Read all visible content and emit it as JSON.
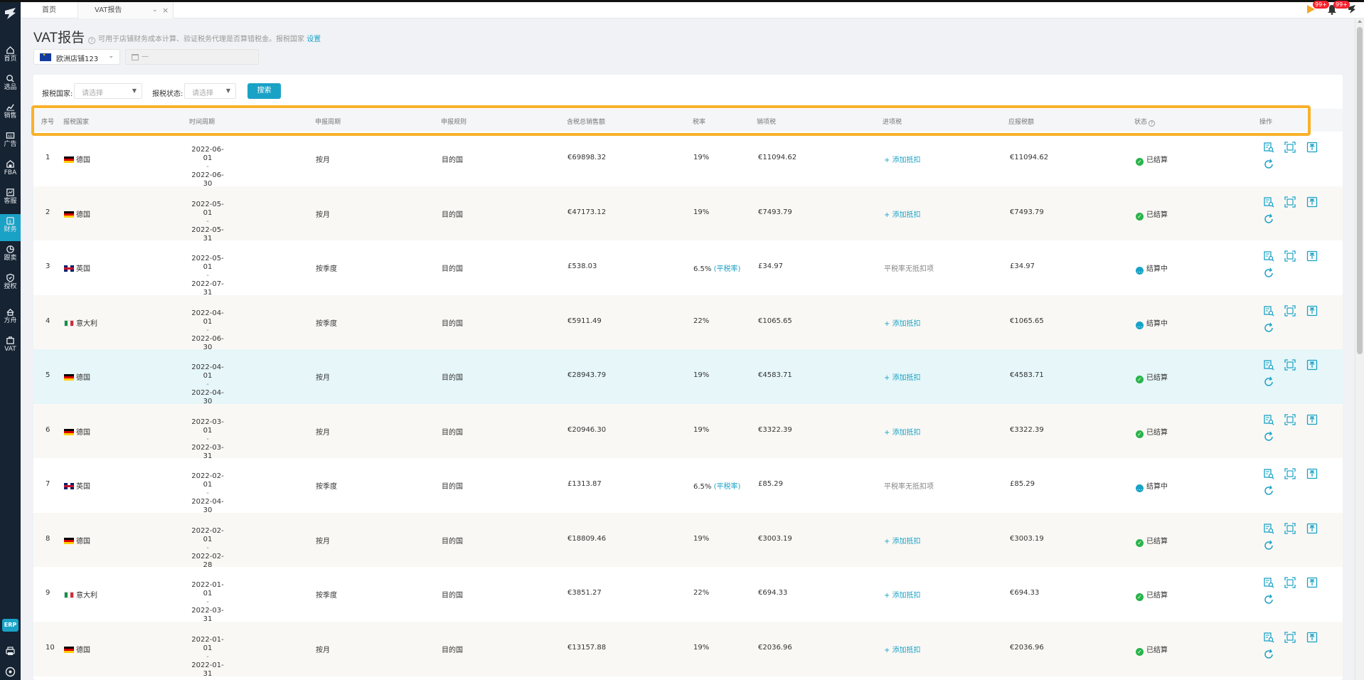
{
  "tabs": {
    "home": "首页",
    "current": "VAT报告"
  },
  "badges": {
    "msg": "99+",
    "notice": "99+"
  },
  "sidebar": {
    "items": [
      {
        "label": "首页",
        "icon": "home-icon"
      },
      {
        "label": "选品",
        "icon": "search-icon"
      },
      {
        "label": "销售",
        "icon": "chart-icon"
      },
      {
        "label": "广告",
        "icon": "ad-icon"
      },
      {
        "label": "FBA",
        "icon": "warehouse-icon"
      },
      {
        "label": "客服",
        "icon": "service-icon"
      },
      {
        "label": "财务",
        "icon": "finance-icon"
      },
      {
        "label": "跟卖",
        "icon": "pie-icon"
      },
      {
        "label": "授权",
        "icon": "shield-icon"
      },
      {
        "label": "方舟",
        "icon": "ark-icon"
      },
      {
        "label": "VAT",
        "icon": "vat-icon"
      }
    ],
    "erp": "ERP"
  },
  "header": {
    "title": "VAT报告",
    "hint": "可用于店铺财务成本计算、验证税务代理是否算错税金。报税国家",
    "hint_link": "设置",
    "store": "欧洲店铺123",
    "date_placeholder": "—"
  },
  "filters": {
    "country_label": "报税国家:",
    "country_placeholder": "请选择",
    "status_label": "报税状态:",
    "status_placeholder": "请选择",
    "search_label": "搜索"
  },
  "table": {
    "headers": {
      "index": "序号",
      "country": "报税国家",
      "period": "时间周期",
      "report_period": "申报周期",
      "rule": "申报规则",
      "sales": "含税总销售额",
      "rate": "税率",
      "output_tax": "销项税",
      "input_tax": "进项税",
      "payable": "应报税额",
      "status": "状态",
      "action": "操作"
    },
    "rows": [
      {
        "no": "1",
        "flag": "de",
        "country": "德国",
        "start": "2022-06-01",
        "end": "2022-06-30",
        "cycle": "按月",
        "rule": "目的国",
        "sales": "€69898.32",
        "rate": "19%",
        "flat": "",
        "output": "€11094.62",
        "input": "+ 添加抵扣",
        "input_link": true,
        "payable": "€11094.62",
        "status": "已结算",
        "st": "done"
      },
      {
        "no": "2",
        "flag": "de",
        "country": "德国",
        "start": "2022-05-01",
        "end": "2022-05-31",
        "cycle": "按月",
        "rule": "目的国",
        "sales": "€47173.12",
        "rate": "19%",
        "flat": "",
        "output": "€7493.79",
        "input": "+ 添加抵扣",
        "input_link": true,
        "payable": "€7493.79",
        "status": "已结算",
        "st": "done"
      },
      {
        "no": "3",
        "flag": "gb",
        "country": "英国",
        "start": "2022-05-01",
        "end": "2022-07-31",
        "cycle": "按季度",
        "rule": "目的国",
        "sales": "£538.03",
        "rate": "6.5%",
        "flat": "(平税率)",
        "output": "£34.97",
        "input": "平税率无抵扣项",
        "input_link": false,
        "payable": "£34.97",
        "status": "结算中",
        "st": "pending"
      },
      {
        "no": "4",
        "flag": "it",
        "country": "意大利",
        "start": "2022-04-01",
        "end": "2022-06-30",
        "cycle": "按季度",
        "rule": "目的国",
        "sales": "€5911.49",
        "rate": "22%",
        "flat": "",
        "output": "€1065.65",
        "input": "+ 添加抵扣",
        "input_link": true,
        "payable": "€1065.65",
        "status": "结算中",
        "st": "pending"
      },
      {
        "no": "5",
        "flag": "de",
        "country": "德国",
        "start": "2022-04-01",
        "end": "2022-04-30",
        "cycle": "按月",
        "rule": "目的国",
        "sales": "€28943.79",
        "rate": "19%",
        "flat": "",
        "output": "€4583.71",
        "input": "+ 添加抵扣",
        "input_link": true,
        "payable": "€4583.71",
        "status": "已结算",
        "st": "done"
      },
      {
        "no": "6",
        "flag": "de",
        "country": "德国",
        "start": "2022-03-01",
        "end": "2022-03-31",
        "cycle": "按月",
        "rule": "目的国",
        "sales": "€20946.30",
        "rate": "19%",
        "flat": "",
        "output": "€3322.39",
        "input": "+ 添加抵扣",
        "input_link": true,
        "payable": "€3322.39",
        "status": "已结算",
        "st": "done"
      },
      {
        "no": "7",
        "flag": "gb",
        "country": "英国",
        "start": "2022-02-01",
        "end": "2022-04-30",
        "cycle": "按季度",
        "rule": "目的国",
        "sales": "£1313.87",
        "rate": "6.5%",
        "flat": "(平税率)",
        "output": "£85.29",
        "input": "平税率无抵扣项",
        "input_link": false,
        "payable": "£85.29",
        "status": "结算中",
        "st": "pending"
      },
      {
        "no": "8",
        "flag": "de",
        "country": "德国",
        "start": "2022-02-01",
        "end": "2022-02-28",
        "cycle": "按月",
        "rule": "目的国",
        "sales": "€18809.46",
        "rate": "19%",
        "flat": "",
        "output": "€3003.19",
        "input": "+ 添加抵扣",
        "input_link": true,
        "payable": "€3003.19",
        "status": "已结算",
        "st": "done"
      },
      {
        "no": "9",
        "flag": "it",
        "country": "意大利",
        "start": "2022-01-01",
        "end": "2022-03-31",
        "cycle": "按季度",
        "rule": "目的国",
        "sales": "€3851.27",
        "rate": "22%",
        "flat": "",
        "output": "€694.33",
        "input": "+ 添加抵扣",
        "input_link": true,
        "payable": "€694.33",
        "status": "已结算",
        "st": "done"
      },
      {
        "no": "10",
        "flag": "de",
        "country": "德国",
        "start": "2022-01-01",
        "end": "2022-01-31",
        "cycle": "按月",
        "rule": "目的国",
        "sales": "€13157.88",
        "rate": "19%",
        "flat": "",
        "output": "€2036.96",
        "input": "+ 添加抵扣",
        "input_link": true,
        "payable": "€2036.96",
        "status": "已结算",
        "st": "done"
      }
    ]
  },
  "colors": {
    "accent": "#1aa2c6",
    "highlight": "#f8b12a",
    "settled": "#28b44a"
  }
}
